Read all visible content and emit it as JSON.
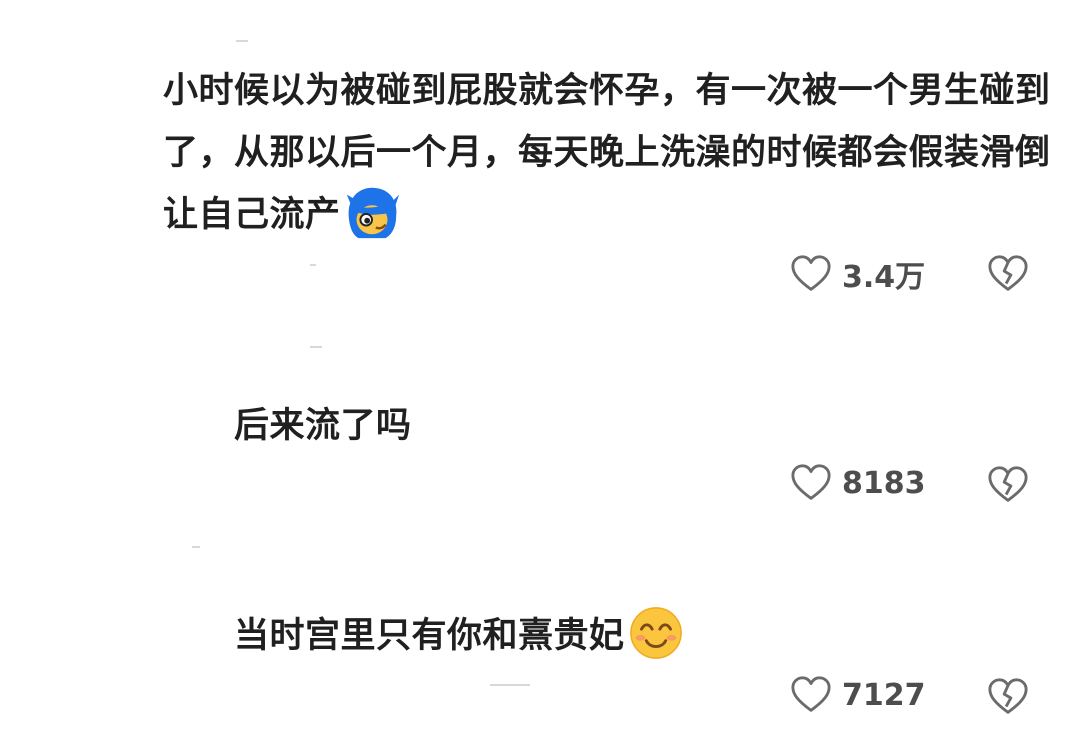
{
  "comments": [
    {
      "text": "小时候以为被碰到屁股就会怀孕，有一次被一个男生碰到了，从那以后一个月，每天晚上洗澡的时候都会假装滑倒让自己流产",
      "emoji": "blue-hair-peeking-emoji",
      "likes": "3.4万"
    },
    {
      "text": "后来流了吗",
      "likes": "8183"
    },
    {
      "text": "当时宫里只有你和熹贵妃",
      "emoji": "smiling-face-emoji",
      "likes": "7127"
    }
  ],
  "colors": {
    "text": "#202020",
    "count": "#4d4d4d",
    "icon": "#6b6b6b"
  },
  "icons": {
    "like": "heart-outline-icon",
    "dislike": "broken-heart-icon"
  }
}
